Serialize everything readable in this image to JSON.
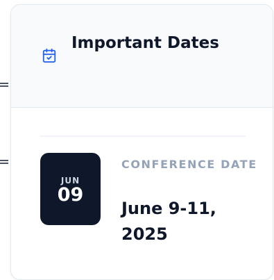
{
  "card": {
    "title": "Important Dates",
    "icon": "calendar-check-icon",
    "accent_color": "#2563eb"
  },
  "events": [
    {
      "month": "JUN",
      "day": "09",
      "label": "CONFERENCE DATE",
      "date": "June 9-11, 2025"
    }
  ]
}
